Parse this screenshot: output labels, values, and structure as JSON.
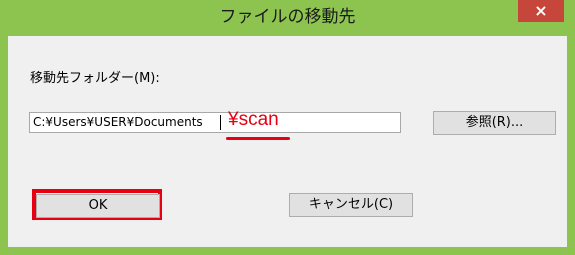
{
  "window": {
    "title": "ファイルの移動先",
    "close_glyph": "×"
  },
  "form": {
    "folder_label": "移動先フォルダー(M):",
    "path_value": "C:¥Users¥USER¥Documents",
    "annotation_text": "¥scan",
    "browse_label": "参照(R)...",
    "ok_label": "OK",
    "cancel_label": "キャンセル(C)"
  },
  "colors": {
    "title_bar": "#8cc44f",
    "close_button": "#c7463c",
    "annotation_red": "#e60012",
    "dialog_background": "#f0f0f0"
  }
}
